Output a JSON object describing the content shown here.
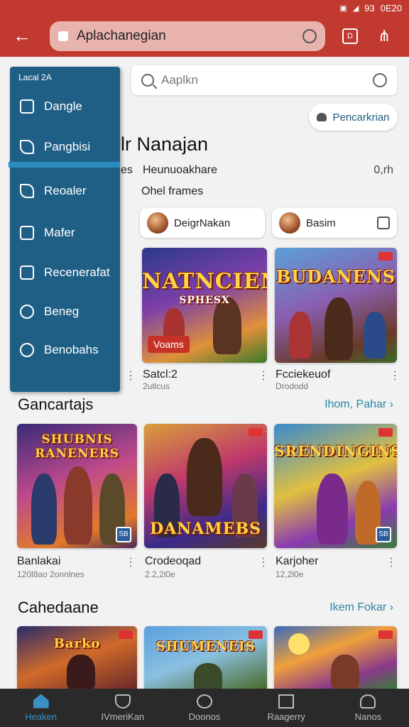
{
  "status": {
    "signal": "93",
    "time": "0E20"
  },
  "browser": {
    "url": "Aplachanegian"
  },
  "search": {
    "placeholder": "Aaplkn"
  },
  "filter_button": "Pencarkrian",
  "drawer": {
    "header": "Lacal 2A",
    "items": [
      "Dangle",
      "Pangbisi",
      "Reoaler",
      "Mafer",
      "Recenerafat",
      "Beneg",
      "Benobahs"
    ]
  },
  "section1": {
    "title": "lr Nanajan",
    "left_fragment": "es",
    "subtitle": "Heunuoakhare",
    "count": "0,rh",
    "row_label": "Ohel frames",
    "chips": [
      "DeigrNakan",
      "Basim"
    ],
    "cards": [
      {
        "art": "NATNCIEN",
        "art2": "SPHESX",
        "tag": "Voams",
        "name": "Satcl:2",
        "sub": "2utlcus"
      },
      {
        "art": "BUDANENS",
        "name": "Fcciekeuof",
        "sub": "Drododd"
      }
    ]
  },
  "section2": {
    "title": "Gancartajs",
    "more": "Ihom, Pahar",
    "cards": [
      {
        "art": "SHUBNIS RANENERS",
        "name": "Banlakai",
        "sub": "120l8ao 2onnlnes"
      },
      {
        "art": "DANAMEBS",
        "name": "Crodeoqad",
        "sub": "2.2,2l0e"
      },
      {
        "art": "SRENDINGINS",
        "name": "Karjoher",
        "sub": "12,2l0e"
      }
    ]
  },
  "section3": {
    "title": "Cahedaane",
    "more": "Ikem Fokar",
    "cards": [
      {
        "art": "Barko"
      },
      {
        "art": "SHUMENEIS"
      },
      {
        "art": ""
      }
    ]
  },
  "bottom_nav": [
    "Heaken",
    "IVmeriKan",
    "Doonos",
    "Raagerry",
    "Nanos"
  ],
  "colors": {
    "header": "#c23a2f",
    "drawer": "#1f5f86",
    "link": "#2a86a8",
    "nav_bg": "#2a2a2a",
    "nav_active": "#3c8fc4"
  }
}
